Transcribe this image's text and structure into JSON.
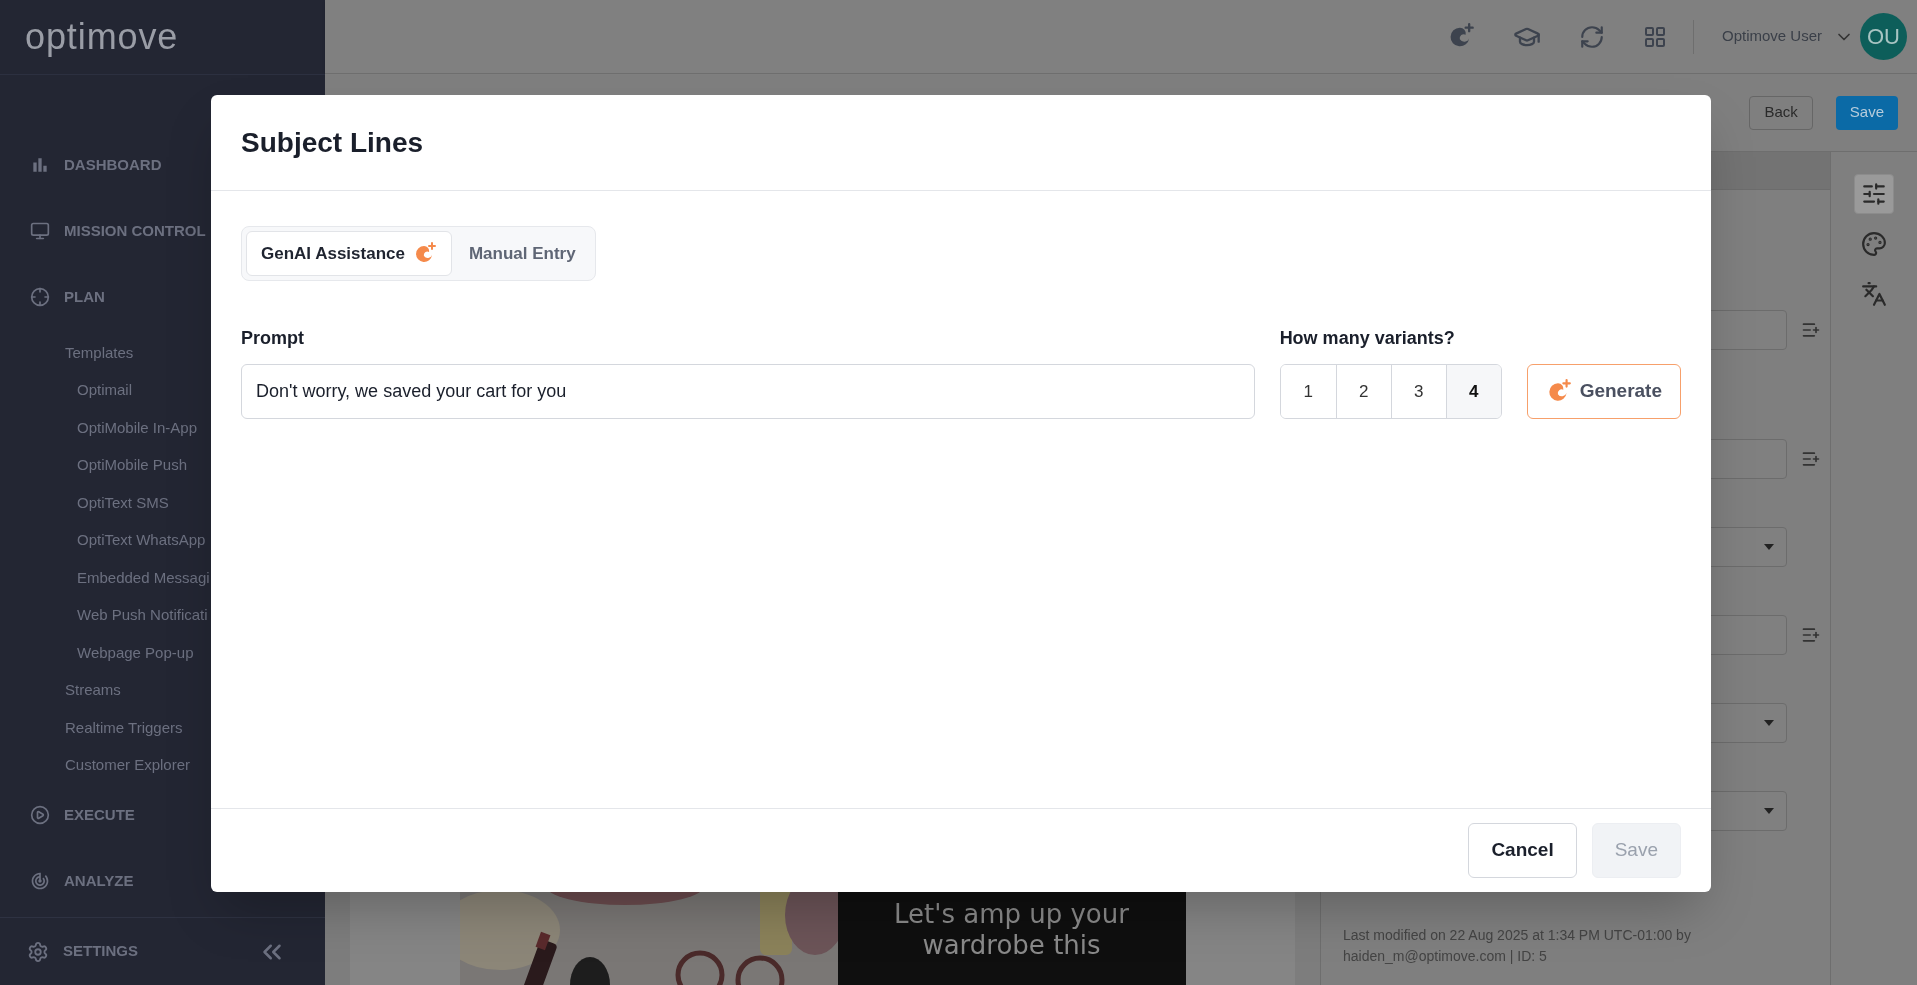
{
  "sidebar": {
    "logo": "optimove",
    "items": [
      {
        "label": "DASHBOARD"
      },
      {
        "label": "MISSION CONTROL"
      },
      {
        "label": "PLAN",
        "children": [
          {
            "label": "Templates",
            "children": [
              {
                "label": "Optimail"
              },
              {
                "label": "OptiMobile In-App"
              },
              {
                "label": "OptiMobile Push"
              },
              {
                "label": "OptiText SMS"
              },
              {
                "label": "OptiText WhatsApp"
              },
              {
                "label": "Embedded Messagi"
              },
              {
                "label": "Web Push Notificati"
              },
              {
                "label": "Webpage Pop-up"
              }
            ]
          },
          {
            "label": "Streams"
          },
          {
            "label": "Realtime Triggers"
          },
          {
            "label": "Customer Explorer"
          }
        ]
      },
      {
        "label": "EXECUTE"
      },
      {
        "label": "ANALYZE"
      }
    ],
    "settings": "SETTINGS"
  },
  "topbar": {
    "user": "Optimove User",
    "avatar": "OU"
  },
  "toolbar": [
    {
      "label": "Back",
      "kind": "outline"
    },
    {
      "label": "Save",
      "kind": "primary"
    }
  ],
  "panel": {
    "fields": [
      {
        "kind": "text"
      },
      {
        "kind": "text"
      },
      {
        "kind": "select"
      },
      {
        "kind": "text"
      },
      {
        "kind": "select"
      },
      {
        "kind": "select"
      }
    ],
    "note": "Last modified on 22 Aug 2025 at 1:34 PM UTC-01:00 by haiden_m@optimove.com | ID: 5"
  },
  "rail": [
    {
      "selected": true
    },
    {
      "selected": false
    },
    {
      "selected": false
    }
  ],
  "preview": {
    "headline": "Let's amp up your wardrobe this"
  },
  "modal": {
    "title": "Subject Lines",
    "tabs": [
      {
        "label": "GenAI Assistance",
        "selected": true,
        "kind": "ai"
      },
      {
        "label": "Manual Entry",
        "selected": false,
        "kind": "plain"
      }
    ],
    "prompt": {
      "label": "Prompt",
      "value": "Don't worry, we saved your cart for you"
    },
    "variants": {
      "label": "How many variants?",
      "options": [
        {
          "label": "1",
          "selected": false
        },
        {
          "label": "2",
          "selected": false
        },
        {
          "label": "3",
          "selected": false
        },
        {
          "label": "4",
          "selected": true
        }
      ]
    },
    "generate": "Generate",
    "buttons": [
      {
        "label": "Cancel",
        "disabled": false
      },
      {
        "label": "Save",
        "disabled": true
      }
    ]
  }
}
